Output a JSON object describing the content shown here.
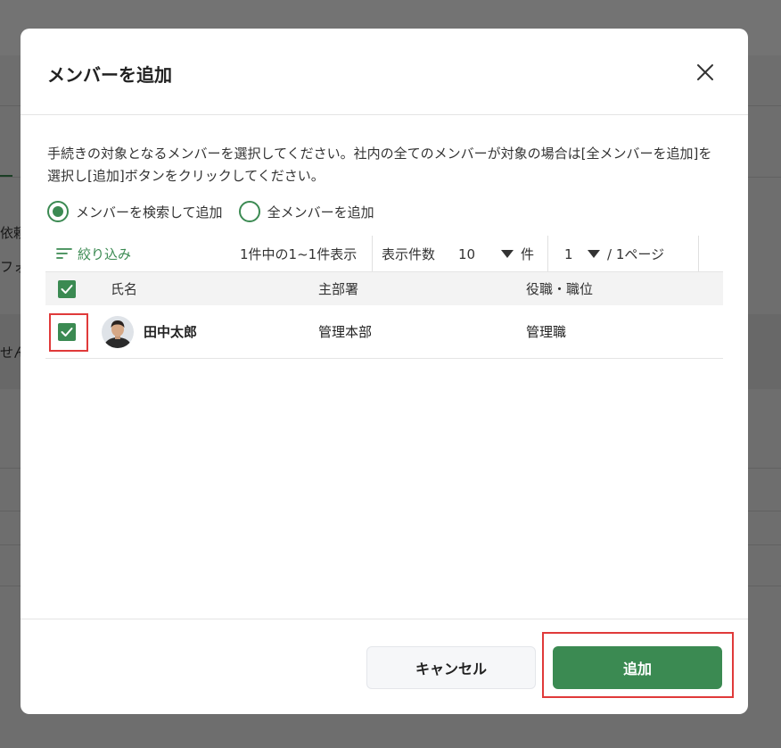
{
  "dialog": {
    "title": "メンバーを追加",
    "description": "手続きの対象となるメンバーを選択してください。社内の全てのメンバーが対象の場合は[全メンバーを追加]を選択し[追加]ボタンをクリックしてください。",
    "radio_options": [
      {
        "label": "メンバーを検索して追加",
        "checked": true
      },
      {
        "label": "全メンバーを追加",
        "checked": false
      }
    ]
  },
  "toolbar": {
    "filter_label": "絞り込み",
    "count_text": "1件中の1~1件表示",
    "per_page_label": "表示件数",
    "per_page_value": "10",
    "per_page_unit": "件",
    "page_value": "1",
    "page_suffix": "/ 1ページ"
  },
  "table": {
    "headers": [
      "氏名",
      "主部署",
      "役職・職位"
    ],
    "rows": [
      {
        "name": "田中太郎",
        "dept": "管理本部",
        "role": "管理職",
        "checked": true
      }
    ]
  },
  "footer": {
    "cancel_label": "キャンセル",
    "add_label": "追加"
  },
  "background": {
    "text1": "依頼",
    "text2": "フォ",
    "text3": "せん"
  },
  "colors": {
    "accent": "#3b8a52",
    "highlight": "#e03a3a"
  }
}
